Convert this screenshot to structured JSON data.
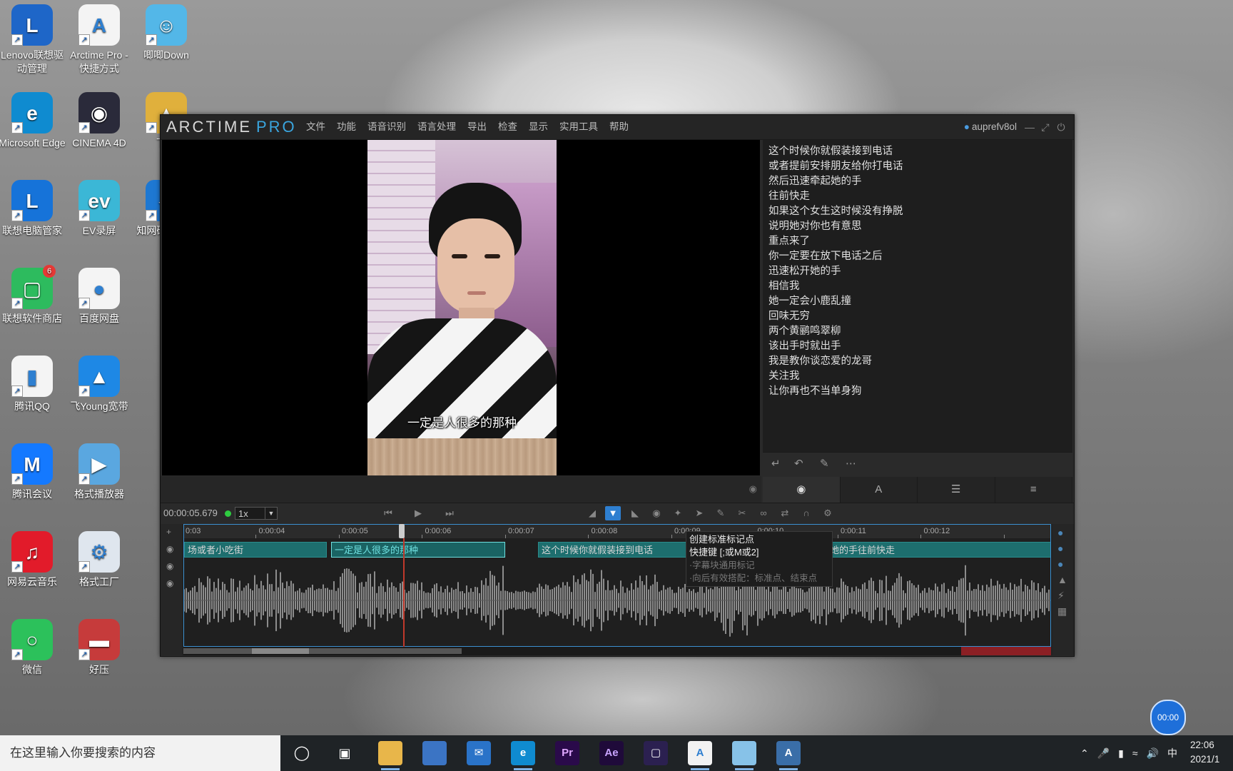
{
  "desktop": {
    "icons": [
      {
        "label": "Lenovo联想驱动管理",
        "color": "#1e66c8"
      },
      {
        "label": "Arctime Pro - 快捷方式",
        "color": "#f4f4f4"
      },
      {
        "label": "唧唧Down",
        "color": "#53b7e8"
      },
      {
        "label": "Microsoft Edge",
        "color": "#0f8bd0"
      },
      {
        "label": "CINEMA 4D",
        "color": "#2a2a3a"
      },
      {
        "label": "下载",
        "color": "#e0b03c"
      },
      {
        "label": "联想电脑管家",
        "color": "#1673d9"
      },
      {
        "label": "EV录屏",
        "color": "#3bb7d6"
      },
      {
        "label": "知网研学 E-S",
        "color": "#1e78d2"
      },
      {
        "label": "联想软件商店",
        "color": "#2dbb5e",
        "badge": "6"
      },
      {
        "label": "百度网盘",
        "color": "#f4f4f4"
      },
      {
        "label": "腾讯QQ",
        "color": "#f4f4f4"
      },
      {
        "label": "飞Young宽带",
        "color": "#1e88e5"
      },
      {
        "label": "腾讯会议",
        "color": "#1479ff"
      },
      {
        "label": "格式播放器",
        "color": "#5aa7e0"
      },
      {
        "label": "网易云音乐",
        "color": "#e21b2a"
      },
      {
        "label": "格式工厂",
        "color": "#dfe6ee"
      },
      {
        "label": "微信",
        "color": "#2cc15b"
      },
      {
        "label": "好压",
        "color": "#c63b3b"
      }
    ]
  },
  "app": {
    "logo": "ARCTIME",
    "logo_pro": "PRO",
    "menu": [
      "文件",
      "功能",
      "语音识别",
      "语言处理",
      "导出",
      "检查",
      "显示",
      "实用工具",
      "帮助"
    ],
    "user": "auprefv8ol",
    "video_subtitle": "一定是人很多的那种",
    "transcript": [
      "这个时候你就假装接到电话",
      "或者提前安排朋友给你打电话",
      "然后迅速牵起她的手",
      "往前快走",
      "如果这个女生这时候没有挣脱",
      "说明她对你也有意思",
      "重点来了",
      "你一定要在放下电话之后",
      "迅速松开她的手",
      "相信我",
      "她一定会小鹿乱撞",
      "回味无穷",
      "两个黄鹂鸣翠柳",
      "该出手时就出手",
      "我是教你谈恋爱的龙哥",
      "关注我",
      "让你再也不当单身狗"
    ],
    "timecode": "00:00:05.679",
    "speed": "1x",
    "ruler_ticks": [
      "0:03",
      "0:00:04",
      "0:00:05",
      "0:00:06",
      "0:00:07",
      "0:00:08",
      "0:00:09",
      "0:00:10",
      "0:00:11",
      "0:00:12"
    ],
    "segments": [
      {
        "text": "场或者小吃街"
      },
      {
        "text": "一定是人很多的那种"
      },
      {
        "text": "这个时候你就假装接到电话"
      },
      {
        "text": "然后迅速牵起她的手往前快走"
      }
    ],
    "tooltip": {
      "title": "创建标准标记点",
      "shortcut": "快捷键 [;或M或2]",
      "desc1": "·字幕块通用标记",
      "desc2": "·向后有效搭配：标准点、结束点"
    }
  },
  "timer": "00:00",
  "taskbar": {
    "search_placeholder": "在这里输入你要搜索的内容",
    "ime": "中",
    "time": "22:06",
    "date": "2021/1"
  }
}
